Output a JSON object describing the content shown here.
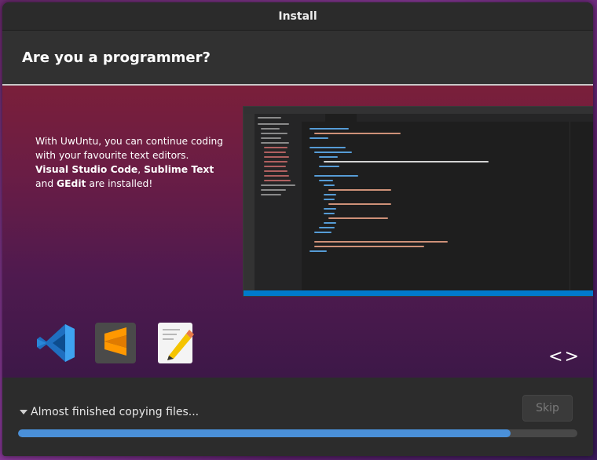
{
  "window": {
    "title": "Install"
  },
  "page": {
    "heading": "Are you a programmer?"
  },
  "slide": {
    "text_line1": "With UwUntu, you can continue coding",
    "text_line2": "with your favourite text editors.",
    "editor1": "Visual Studio Code",
    "comma": ", ",
    "editor2": "Sublime Text",
    "and_word": "and ",
    "editor3": "GEdit",
    "suffix": " are installed!",
    "apps": [
      {
        "icon": "vscode-icon"
      },
      {
        "icon": "sublime-text-icon"
      },
      {
        "icon": "gedit-icon"
      }
    ],
    "nav": {
      "prev": "<",
      "next": ">"
    }
  },
  "footer": {
    "status_text": "Almost finished copying files...",
    "skip_label": "Skip",
    "progress_fraction": 0.88
  },
  "colors": {
    "accent": "#4a90d9",
    "vscode_blue": "#0078d4",
    "sublime_orange": "#ff9800"
  }
}
